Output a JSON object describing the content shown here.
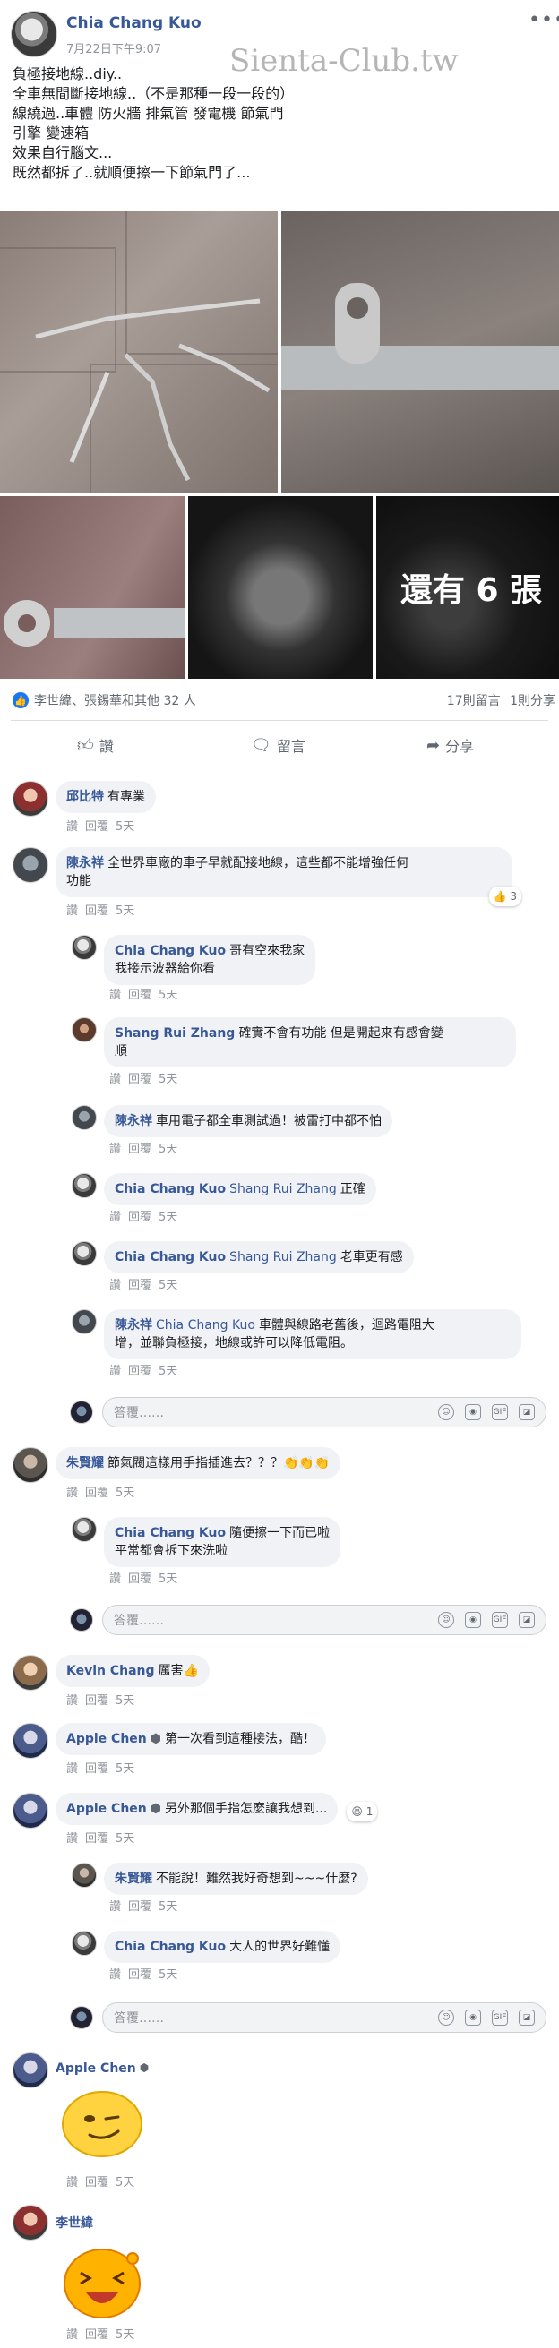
{
  "post": {
    "author": "Chia Chang Kuo",
    "date": "7月22日下午9:07",
    "more_icon": "more-horizontal-icon",
    "watermark": "Sienta-Club.tw",
    "text_lines": [
      "負極接地線..diy..",
      "全車無間斷接地線..（不是那種一段一段的）",
      "線繞過..車體 防火牆 排氣管 發電機 節氣門",
      "引擎 變速箱",
      "效果自行腦文...",
      "既然都拆了..就順便擦一下節氣門了..."
    ],
    "more_photos_label": "還有 6 張"
  },
  "stats": {
    "reactions_label": "李世緯、張錫華和其他 32 人",
    "comments_label": "17則留言",
    "shares_label": "1則分享"
  },
  "actions": {
    "like": "讚",
    "comment": "留言",
    "share": "分享"
  },
  "comment_meta": {
    "like": "讚",
    "reply": "回覆",
    "time": "5天"
  },
  "comments": [
    {
      "name": "邱比特",
      "text": "有專業"
    },
    {
      "name": "陳永祥",
      "text_line1": "全世界車廠的車子早就配接地線，這些都不能增強任何",
      "text_line2": "功能",
      "reactions": "3"
    },
    {
      "name": "Chia Chang Kuo",
      "text_line1": "哥有空來我家",
      "text_line2": "我接示波器給你看"
    },
    {
      "name": "Shang Rui Zhang",
      "text_line1": "確實不會有功能 但是開起來有感會變",
      "text_line2": "順"
    },
    {
      "name": "陳永祥",
      "text": "車用電子都全車測試過！被雷打中都不怕"
    },
    {
      "name": "Chia Chang Kuo",
      "tag": "Shang Rui Zhang",
      "text": "正確"
    },
    {
      "name": "Chia Chang Kuo",
      "tag": "Shang Rui Zhang",
      "text": "老車更有感"
    },
    {
      "name": "陳永祥",
      "tag": "Chia Chang Kuo",
      "text_line1": "車體與線路老舊後，迴路電阻大",
      "text_line2": "增，並聯負極接，地線或許可以降低電阻。"
    },
    {
      "name": "朱賢耀",
      "text": "節氣閥這樣用手指插進去？？？👏👏👏"
    },
    {
      "name": "Chia Chang Kuo",
      "text_line1": "隨便擦一下而已啦",
      "text_line2": "平常都會拆下來洗啦"
    },
    {
      "name": "Kevin Chang",
      "text": "厲害👍"
    },
    {
      "name": "Apple Chen",
      "text": "第一次看到這種接法，酷！"
    },
    {
      "name": "Apple Chen",
      "text": "另外那個手指怎麼讓我想到...",
      "reactions": "1"
    },
    {
      "name": "朱賢耀",
      "text": "不能說！難然我好奇想到~~~什麼?"
    },
    {
      "name": "Chia Chang Kuo",
      "text": "大人的世界好難懂"
    },
    {
      "name": "Apple Chen"
    },
    {
      "name": "李世緯"
    }
  ],
  "reply_placeholder": "答覆……",
  "colors": {
    "link": "#385898",
    "bubble": "#f0f2f5",
    "like_blue": "#1877f2"
  }
}
